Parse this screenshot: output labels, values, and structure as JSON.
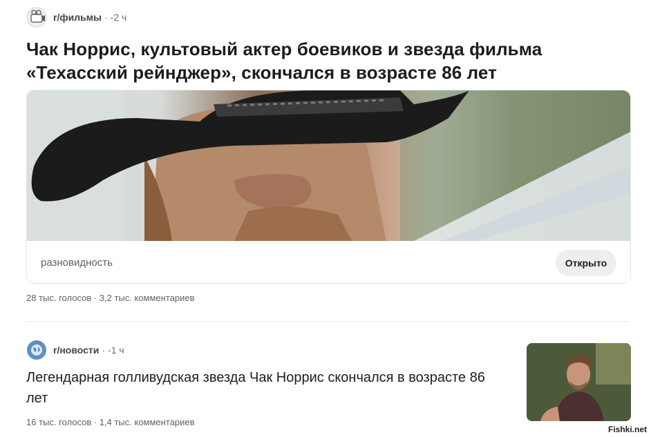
{
  "post1": {
    "subreddit": "r/фильмы",
    "separator": "·",
    "time": "-2 ч",
    "title": "Чак Норрис, культовый актер боевиков и звезда фильма «Техасский рейнджер», скончался в возрасте 86 лет",
    "link_domain": "разновидность",
    "open_button": "Открыто",
    "stats": "28 тыс. голосов · 3,2 тыс. комментариев"
  },
  "post2": {
    "subreddit": "r/новости",
    "separator": "·",
    "time": "-1 ч",
    "title": "Легендарная голливудская звезда Чак Норрис скончался в возрасте 86 лет",
    "stats": "16 тыс. голосов · 1,4 тыс. комментариев"
  },
  "watermark": "Fishki.net",
  "colors": {
    "text": "#1c1c1c",
    "meta": "#6a6f73",
    "button_bg": "#eceef0",
    "border": "#e2e4e6",
    "news_icon": "#5f8fc0"
  },
  "icons": {
    "post1_subreddit": "film-reel-icon",
    "post2_subreddit": "globe-icon"
  }
}
